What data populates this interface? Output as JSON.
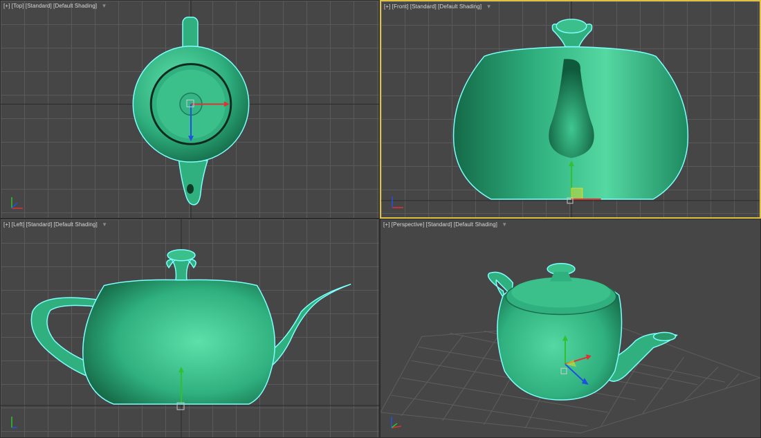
{
  "viewports": [
    {
      "menu": "[+]",
      "view": "[Top]",
      "style": "[Standard]",
      "shading": "[Default Shading]"
    },
    {
      "menu": "[+]",
      "view": "[Front]",
      "style": "[Standard]",
      "shading": "[Default Shading]"
    },
    {
      "menu": "[+]",
      "view": "[Left]",
      "style": "[Standard]",
      "shading": "[Default Shading]"
    },
    {
      "menu": "[+]",
      "view": "[Perspective]",
      "style": "[Standard]",
      "shading": "[Default Shading]"
    }
  ],
  "active_viewport": "Front",
  "icons": [
    "filter-icon",
    "axis-gizmo-icon",
    "transform-gizmo-icon"
  ],
  "colors": {
    "teapot": "#2fb07e",
    "selection_outline": "#7fffff",
    "active_border": "#e2c243",
    "viewport_bg": "#464646",
    "x_axis": "#e03030",
    "y_axis": "#30c030",
    "z_axis": "#2050e0"
  }
}
